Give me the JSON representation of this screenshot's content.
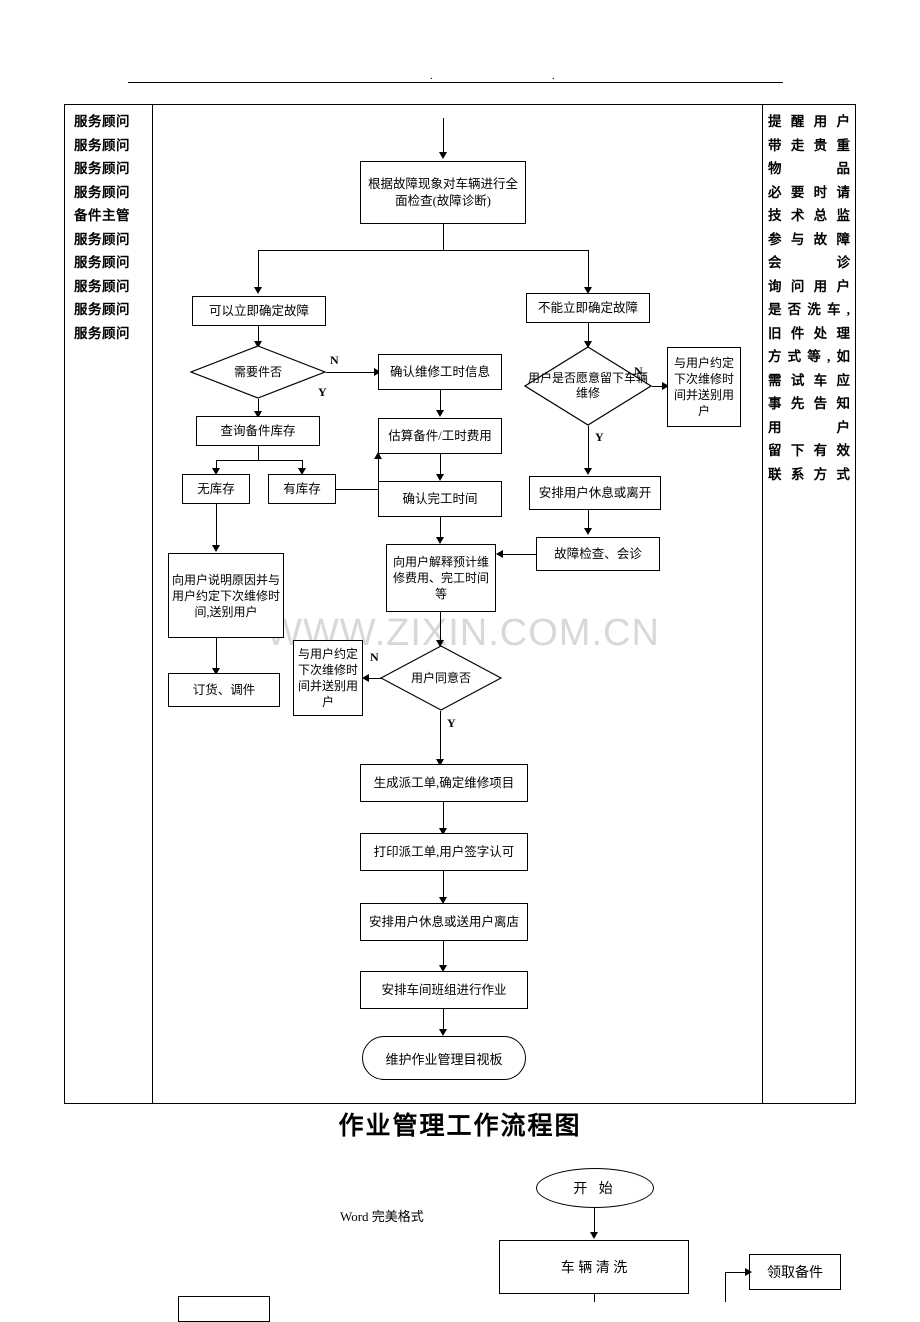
{
  "header": {
    "rule_dots": [
      ".",
      "."
    ]
  },
  "watermark": "WWW.ZIXIN.COM.CN",
  "roles": {
    "items": [
      "服务顾问",
      "服务顾问",
      "服务顾问",
      "服务顾问",
      "备件主管",
      "服务顾问",
      "服务顾问",
      "服务顾问",
      "服务顾问",
      "服务顾问"
    ]
  },
  "notes": {
    "items": [
      "提醒用户",
      "带走贵重",
      "物品",
      "必要时请",
      "技术总监",
      "参与故障",
      "会诊",
      "询问用户",
      "是否洗车,",
      "旧件处理",
      "方式等,如",
      "需试车应",
      "事先告知",
      "用户",
      "留下有效",
      "联系方式"
    ]
  },
  "flow": {
    "n1": "根据故障现象对车辆进行全面检查(故障诊断)",
    "n2": "可以立即确定故障",
    "n3": "不能立即确定故障",
    "d1": "需要件否",
    "n4": "确认维修工时信息",
    "d2": "用户是否愿意留下车辆维修",
    "n5": "与用户约定下次维修时间并送别用户",
    "n6": "查询备件库存",
    "n7": "估算备件/工时费用",
    "n8": "安排用户休息或离开",
    "n9": "无库存",
    "n10": "有库存",
    "n11": "确认完工时间",
    "n12": "故障检查、会诊",
    "n13": "向用户说明原因并与用户约定下次维修时间,送别用户",
    "n14": "向用户解释预计维修费用、完工时间等",
    "n15": "订货、调件",
    "n16": "与用户约定下次维修时间并送别用户",
    "d3": "用户同意否",
    "n17": "生成派工单,确定维修项目",
    "n18": "打印派工单,用户签字认可",
    "n19": "安排用户休息或送用户离店",
    "n20": "安排车间班组进行作业",
    "n21": "维护作业管理目视板",
    "labels": {
      "n_1": "N",
      "y_1": "Y",
      "n_2": "N",
      "y_2": "Y",
      "n_3": "N",
      "y_3": "Y"
    }
  },
  "doc_title": "作业管理工作流程图",
  "word_note": "Word 完美格式",
  "bottom": {
    "start": "开 始",
    "wash": "车 辆 清 洗",
    "parts": "领取备件"
  }
}
